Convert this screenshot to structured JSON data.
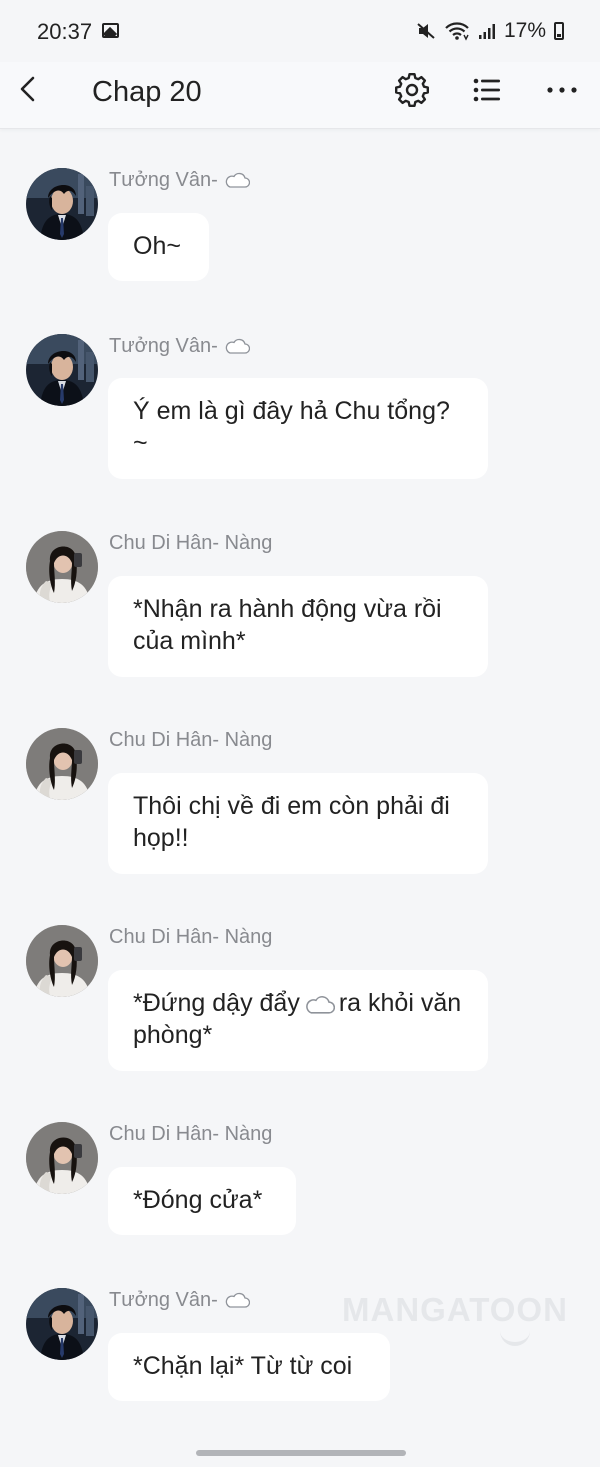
{
  "status_bar": {
    "time": "20:37",
    "battery": "17%",
    "icons": [
      "image-icon",
      "mute-icon",
      "wifi-icon",
      "signal-icon",
      "battery-icon"
    ]
  },
  "header": {
    "title": "Chap 20",
    "icons": [
      "back-icon",
      "gear-icon",
      "list-icon",
      "more-icon"
    ]
  },
  "messages": [
    {
      "sender": "Tưởng Vân-",
      "text": "Oh~"
    },
    {
      "sender": "Tưởng Vân-",
      "text": "Ý em là gì đây hả Chu tổng? ~"
    },
    {
      "sender": "Chu Di Hân- Nàng",
      "text": "*Nhận ra hành động vừa rồi của mình*"
    },
    {
      "sender": "Chu Di Hân- Nàng",
      "text": "Thôi chị về đi em còn phải đi họp!!"
    },
    {
      "sender": "Chu Di Hân- Nàng",
      "text_before": "*Đứng dậy đẩy",
      "text_after": "ra khỏi văn phòng*"
    },
    {
      "sender": "Chu Di Hân- Nàng",
      "text": "*Đóng cửa*"
    },
    {
      "sender": "Tưởng Vân-",
      "text": "*Chặn lại* Từ từ coi"
    }
  ],
  "watermark": "MANGATOON",
  "colors": {
    "background": "#f5f6f8",
    "bubble": "#ffffff",
    "sender_name": "#888a8f",
    "text": "#222222"
  }
}
